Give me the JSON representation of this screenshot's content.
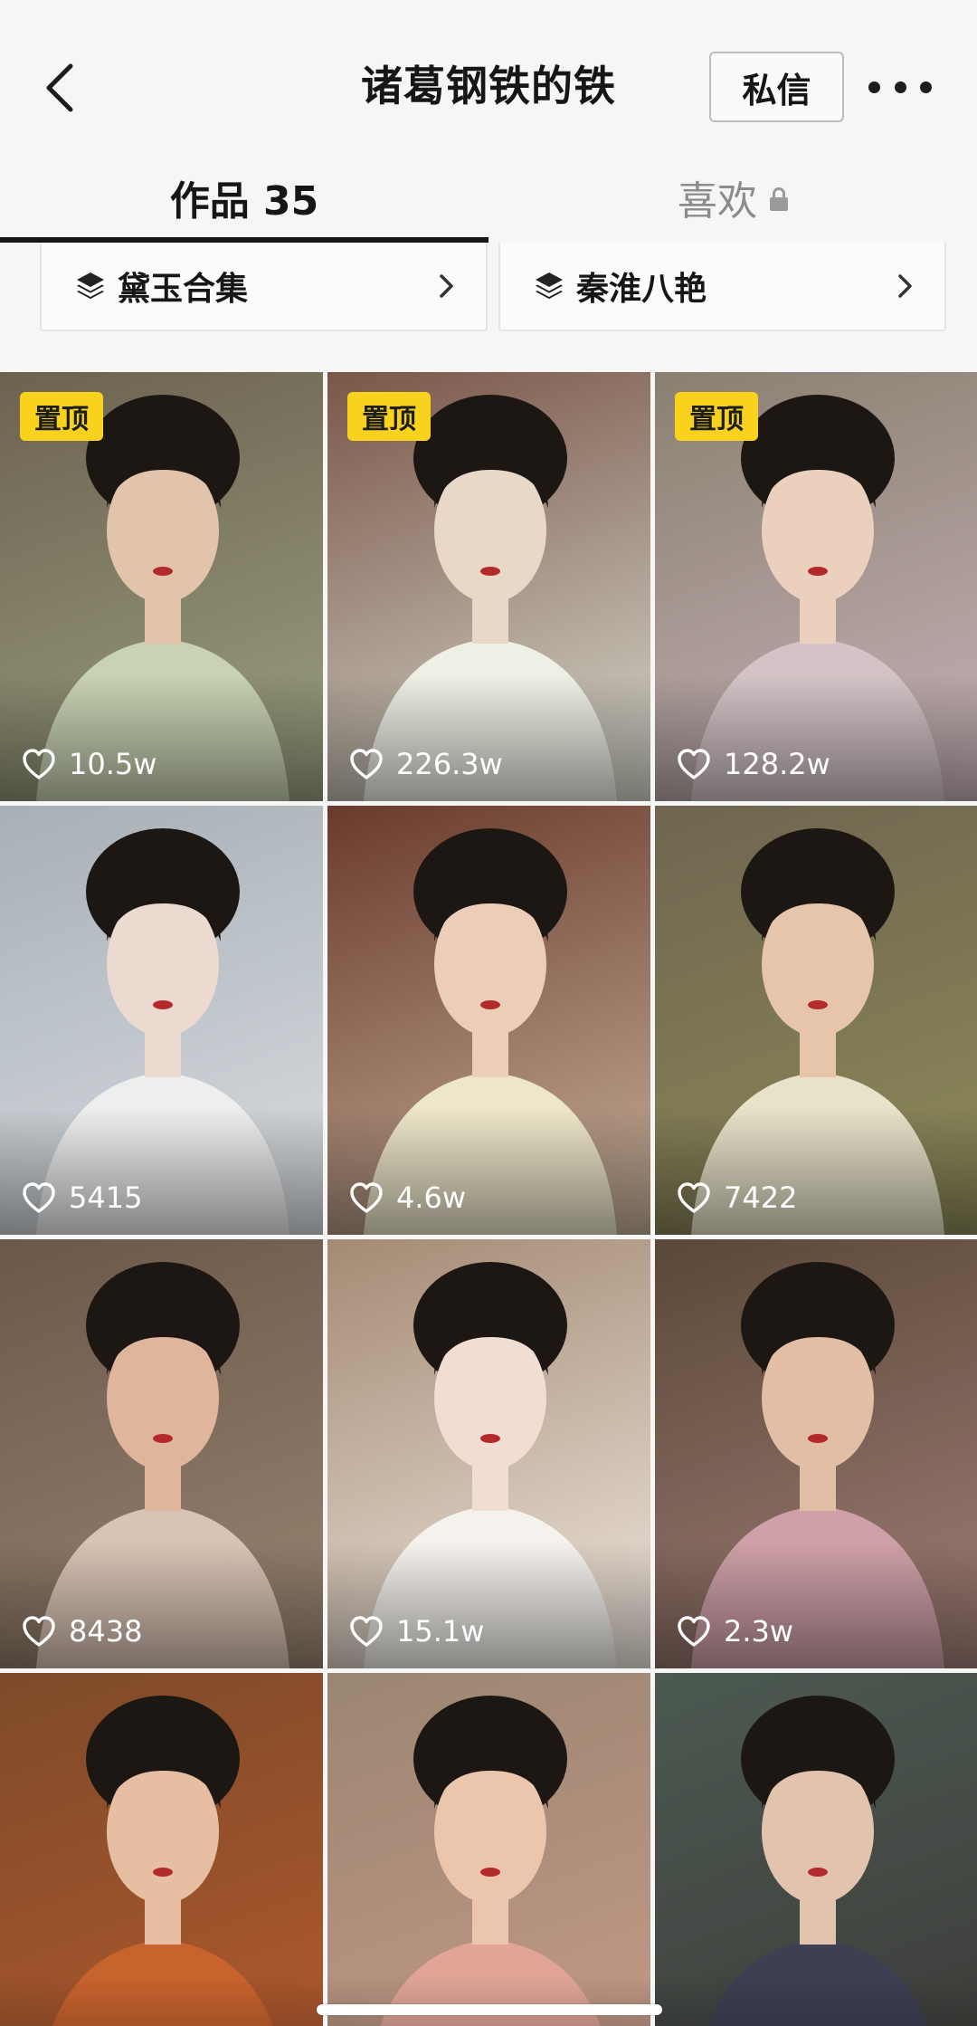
{
  "header": {
    "title": "诸葛钢铁的铁",
    "message_button": "私信",
    "back_icon": "chevron-left-icon",
    "more_icon": "more-horizontal-icon"
  },
  "tabs": [
    {
      "label": "作品 35",
      "active": true
    },
    {
      "label": "喜欢",
      "active": false,
      "icon": "lock-icon"
    }
  ],
  "collections": [
    {
      "label": "黛玉合集",
      "icon": "layers-icon"
    },
    {
      "label": "秦淮八艳",
      "icon": "layers-icon"
    }
  ],
  "pin_label": "置顶",
  "videos": [
    {
      "likes": "10.5w",
      "pinned": true,
      "bg_top": "#6d6250",
      "bg_bottom": "#9aa080",
      "robe": "#c9d2b3",
      "skin": "#e2c3ab"
    },
    {
      "likes": "226.3w",
      "pinned": true,
      "bg_top": "#7a5648",
      "bg_bottom": "#d6d8cd",
      "robe": "#eef0e6",
      "skin": "#e9d7c7"
    },
    {
      "likes": "128.2w",
      "pinned": true,
      "bg_top": "#8a8070",
      "bg_bottom": "#c6b2b8",
      "robe": "#d3c3c6",
      "skin": "#ead0bd"
    },
    {
      "likes": "5415",
      "pinned": false,
      "bg_top": "#a7b0b7",
      "bg_bottom": "#d9dde0",
      "robe": "#eeeeee",
      "skin": "#ecd9cf"
    },
    {
      "likes": "4.6w",
      "pinned": false,
      "bg_top": "#6a3a2c",
      "bg_bottom": "#c6b09a",
      "robe": "#ede6c9",
      "skin": "#ebcdb8"
    },
    {
      "likes": "7422",
      "pinned": false,
      "bg_top": "#6f6550",
      "bg_bottom": "#8d8a58",
      "robe": "#e7e2c9",
      "skin": "#e6c5ab"
    },
    {
      "likes": "8438",
      "pinned": false,
      "bg_top": "#6b5849",
      "bg_bottom": "#9a8572",
      "robe": "#d9c3b4",
      "skin": "#dfb59c"
    },
    {
      "likes": "15.1w",
      "pinned": false,
      "bg_top": "#a48a74",
      "bg_bottom": "#efe7de",
      "robe": "#f5f2ee",
      "skin": "#f1ddd2"
    },
    {
      "likes": "2.3w",
      "pinned": false,
      "bg_top": "#5a4838",
      "bg_bottom": "#a07d76",
      "robe": "#cfa0a8",
      "skin": "#e1bea4"
    },
    {
      "likes": "",
      "pinned": false,
      "bg_top": "#7d4a2a",
      "bg_bottom": "#b45a2c",
      "robe": "#c8632d",
      "skin": "#e6bfa2"
    },
    {
      "likes": "",
      "pinned": false,
      "bg_top": "#9a8672",
      "bg_bottom": "#c79a88",
      "robe": "#e0a596",
      "skin": "#ecc5ad"
    },
    {
      "likes": "",
      "pinned": false,
      "bg_top": "#4c5a52",
      "bg_bottom": "#3c3a38",
      "robe": "#3e3f52",
      "skin": "#e2c4ae"
    }
  ],
  "colors": {
    "background": "#f6f6f6",
    "pin_badge": "#f8d21c",
    "active_tab": "#161616",
    "inactive_tab": "#8c8c8c"
  }
}
